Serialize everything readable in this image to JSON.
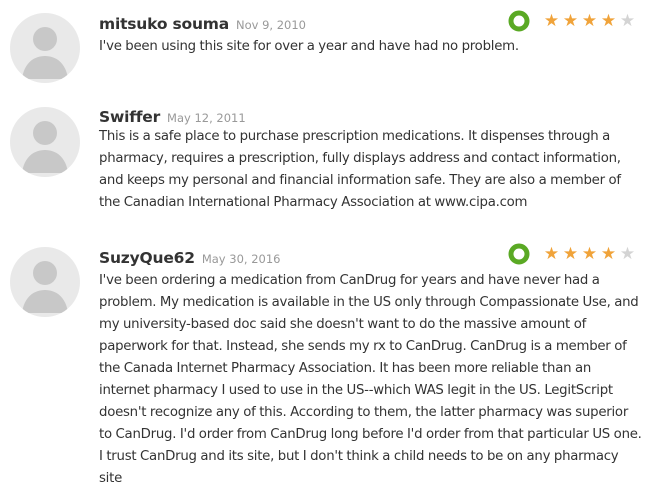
{
  "reviews": [
    {
      "author": "mitsuko souma",
      "date": "Nov 9, 2010",
      "text": "I've been using this site for over a year and have had no problem.",
      "rating": 4,
      "rating_max": 5,
      "has_badge": true,
      "badge_color": "#5aa924"
    },
    {
      "author": "Swiffer",
      "date": "May 12, 2011",
      "text": "This is a safe place to purchase prescription medications. It dispenses through a pharmacy, requires a prescription, fully displays address and contact information, and keeps my personal and financial information safe. They are also a member of the Canadian International Pharmacy Association at www.cipa.com",
      "has_badge": false
    },
    {
      "author": "SuzyQue62",
      "date": "May 30, 2016",
      "text": "I've been ordering a medication from CanDrug for years and have never had a problem. My medication is available in the US only through Compassionate Use, and my university-based doc said she doesn't want to do the massive amount of paperwork for that. Instead, she sends my rx to CanDrug. CanDrug is a member of the Canada Internet Pharmacy Association. It has been more reliable than an internet pharmacy I used to use in the US--which WAS legit in the US. LegitScript doesn't recognize any of this. According to them, the latter pharmacy was superior to CanDrug. I'd order from CanDrug long before I'd order from that particular US one. I trust CanDrug and its site, but I don't think a child needs to be on any pharmacy site",
      "rating": 4,
      "rating_max": 5,
      "has_badge": true,
      "badge_color": "#5aa924"
    }
  ],
  "colors": {
    "star_filled": "#f0a33a",
    "star_empty": "#d4d4d4",
    "avatar_bg": "#e9e9e9",
    "avatar_fg": "#c8c8c8",
    "date_text": "#999999"
  },
  "icons": {
    "avatar": "default-user-avatar-icon",
    "badge": "green-ring-icon",
    "star": "star-icon"
  }
}
